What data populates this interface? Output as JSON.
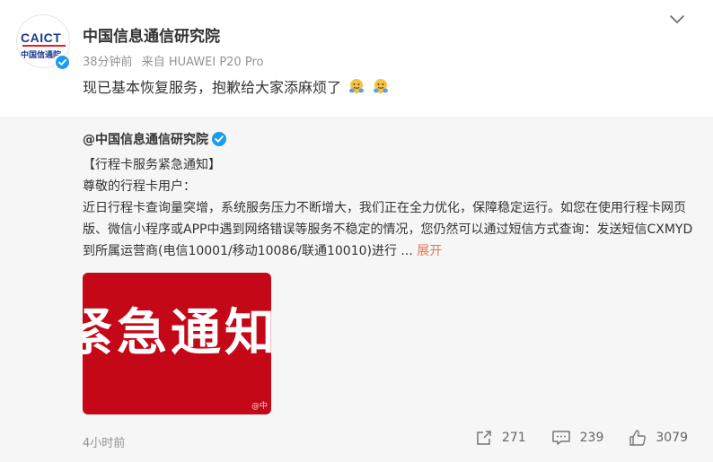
{
  "post": {
    "author": "中国信息通信研究院",
    "avatar": {
      "logo_text": "CAICT",
      "logo_subtext": "中国信通院"
    },
    "time": "38分钟前",
    "source": "来自 HUAWEI P20 Pro",
    "text": "现已基本恢复服务，抱歉给大家添麻烦了"
  },
  "repost": {
    "author": "@中国信息通信研究院",
    "title": "【行程卡服务紧急通知】",
    "greeting": "尊敬的行程卡用户：",
    "body": "近日行程卡查询量突增，系统服务压力不断增大，我们正在全力优化，保障稳定运行。如您在使用行程卡网页版、微信小程序或APP中遇到网络错误等服务不稳定的情况，您仍然可以通过短信方式查询：发送短信CXMYD到所属运营商(电信10001/移动10086/联通10010)进行 ...",
    "expand_label": "展开",
    "image_text": "紧急通知",
    "image_watermark": "@中",
    "time": "4小时前",
    "shares": "271",
    "comments": "239",
    "likes": "3079"
  },
  "colors": {
    "accent": "#eb7350",
    "verified": "#1d9bf0",
    "image_red": "#c40818"
  },
  "icons": [
    "chevron-down-icon",
    "verified-icon",
    "share-icon",
    "comment-icon",
    "like-icon",
    "emoji-icon"
  ]
}
